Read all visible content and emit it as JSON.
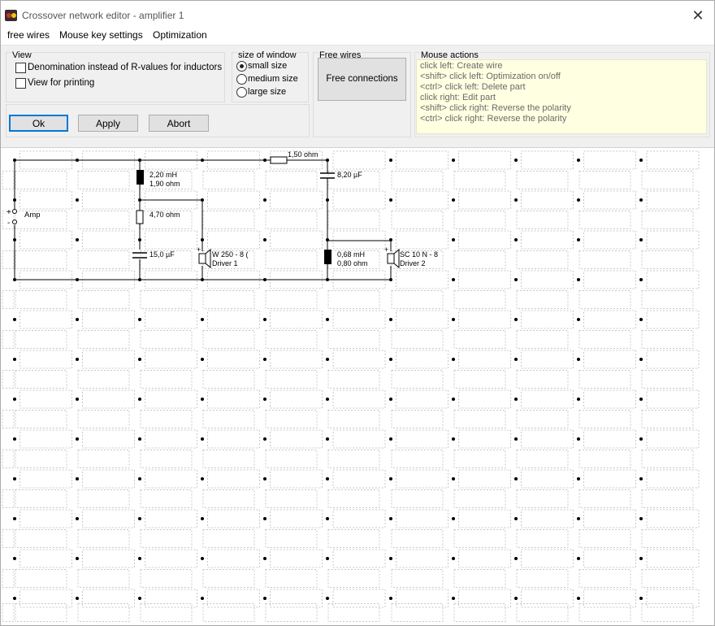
{
  "window": {
    "title": "Crossover network editor - amplifier 1",
    "close_label": "✕",
    "icon": "speaker-app-icon"
  },
  "menu": {
    "items": [
      "free wires",
      "Mouse key settings",
      "Optimization"
    ]
  },
  "view_group": {
    "title": "View",
    "checkbox1_label": "Denomination instead of R-values for inductors",
    "checkbox1_checked": false,
    "checkbox2_label": "View for printing",
    "checkbox2_checked": false
  },
  "size_group": {
    "title": "size of window",
    "options": [
      "small size",
      "medium size",
      "large size"
    ],
    "selected": "small size"
  },
  "free_wires_group": {
    "title": "Free wires",
    "button_label": "Free connections"
  },
  "buttons": {
    "ok": "Ok",
    "apply": "Apply",
    "abort": "Abort"
  },
  "mouse_actions": {
    "title": "Mouse actions",
    "lines": [
      "click left: Create wire",
      "<shift> click left: Optimization on/off",
      "<ctrl> click left: Delete part",
      "click right: Edit part",
      "<shift> click right: Reverse the polarity",
      "<ctrl> click right: Reverse the polarity"
    ]
  },
  "circuit": {
    "amp_label": "Amp",
    "r_series": "1,50 ohm",
    "l1_value": "2,20 mH",
    "l1_resistance": "1,90 ohm",
    "r2": "4,70 ohm",
    "c1": "15,0 µF",
    "c2": "8,20 µF",
    "l2_value": "0,68 mH",
    "l2_resistance": "0,80 ohm",
    "driver1_name": "W 250 - 8 (",
    "driver1_label": "Driver 1",
    "driver2_name": "SC 10 N - 8",
    "driver2_label": "Driver 2",
    "plus": "+",
    "minus": "-"
  }
}
